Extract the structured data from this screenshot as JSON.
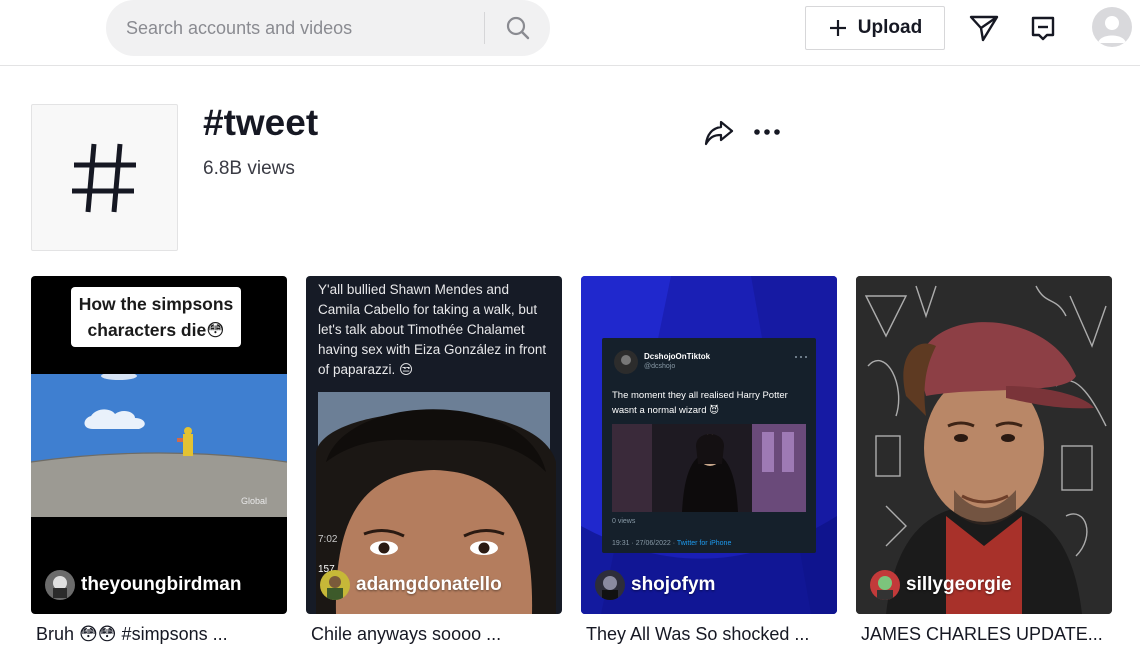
{
  "header": {
    "search_placeholder": "Search accounts and videos",
    "upload_label": "Upload"
  },
  "tag": {
    "title": "#tweet",
    "views": "6.8B views"
  },
  "videos": [
    {
      "overlay_text_line1": "How the simpsons",
      "overlay_text_line2": "characters die😳",
      "watermark": "Global",
      "creator": "theyoungbirdman",
      "caption": "Bruh 😳😳 #simpsons ..."
    },
    {
      "overlay_text": "Y'all bullied Shawn Mendes and Camila Cabello for taking a walk, but let's talk about Timothée Chalamet having sex with Eiza González in front of paparazzi. 😒",
      "timestamp": "7:02",
      "count": "157",
      "creator": "adamgdonatello",
      "caption": "Chile anyways soooo ..."
    },
    {
      "tweet_name": "DcshojoOnTiktok",
      "tweet_handle": "@dcshojo",
      "tweet_text": "The moment they all realised Harry Potter wasnt a normal wizard 😈",
      "tweet_views": "0 views",
      "tweet_date": "19:31 · 27/06/2022 · ",
      "tweet_source": "Twitter for iPhone",
      "creator": "shojofym",
      "caption": "They All Was So shocked ..."
    },
    {
      "creator": "sillygeorgie",
      "caption": "JAMES CHARLES UPDATE..."
    }
  ],
  "colors": {
    "text_primary": "#161823",
    "search_bg": "#f1f1f2",
    "tweet_card_bg": "#15202b",
    "v3_bg": "#1e23c8",
    "link_blue": "#1d9bf0"
  }
}
